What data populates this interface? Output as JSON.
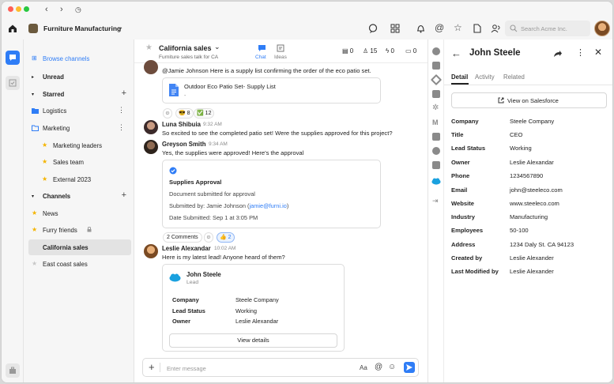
{
  "app": {
    "workspace_name": "Furniture Manufacturing",
    "search_placeholder": "Search Acme Inc."
  },
  "colors": {
    "accent": "#2f7df6",
    "salesforce": "#1aa1df",
    "star": "#f4b400"
  },
  "sidebar": {
    "browse": "Browse channels",
    "unread": "Unread",
    "starred": "Starred",
    "starred_items": [
      {
        "label": "Logistics",
        "icon": "folder-icon"
      },
      {
        "label": "Marketing",
        "icon": "folder-outline-icon"
      },
      {
        "label": "Marketing leaders",
        "icon": "star-icon"
      },
      {
        "label": "Sales team",
        "icon": "star-icon"
      },
      {
        "label": "External 2023",
        "icon": "star-icon"
      }
    ],
    "channels": "Channels",
    "channel_items": [
      {
        "label": "News"
      },
      {
        "label": "Furry friends"
      },
      {
        "label": "California sales"
      },
      {
        "label": "East coast sales"
      }
    ]
  },
  "channel": {
    "name": "California sales",
    "description": "Furniture sales talk for CA",
    "tab_chat": "Chat",
    "tab_ideas": "Ideas",
    "stats": [
      "0",
      "15",
      "0",
      "0"
    ]
  },
  "messages": {
    "m0_text": "@Jamie Johnson Here is a supply list confirming the order of the eco patio set.",
    "m0_file": "Outdoor Eco Patio Set- Supply List",
    "m0_file_sub": "-",
    "m0_react1": "8",
    "m0_react2": "12",
    "m1_name": "Luna Shibuia",
    "m1_time": "9:32 AM",
    "m1_text": "So excited to see the completed patio set! Were the supplies approved for this project?",
    "m2_name": "Greyson Smith",
    "m2_time": "9:34 AM",
    "m2_text": "Yes, the supplies were approved! Here's the approval",
    "approval_title": "Supplies Approval",
    "approval_line1": "Document submitted for approval",
    "approval_line2_prefix": "Submitted by: Jamie Johnson (",
    "approval_line2_link": "jamie@furni.io",
    "approval_line2_suffix": ")",
    "approval_line3": "Date Submitted: Sep 1 at 3:05 PM",
    "m2_comments": "2 Comments",
    "m2_react": "2",
    "m3_name": "Leslie Alexandar",
    "m3_time": "10:02 AM",
    "m3_text": "Here is my latest lead! Anyone heard of them?",
    "lead_name": "John Steele",
    "lead_sub": "Lead",
    "lead_rows": [
      {
        "k": "Company",
        "v": "Steele Company"
      },
      {
        "k": "Lead Status",
        "v": "Working"
      },
      {
        "k": "Owner",
        "v": "Leslie Alexandar"
      }
    ],
    "lead_button": "View details"
  },
  "composer": {
    "placeholder": "Enter message",
    "aa": "Aa"
  },
  "detail": {
    "name": "John Steele",
    "tabs": [
      "Detail",
      "Activity",
      "Related"
    ],
    "view_button": "View on Salesforce",
    "fields": [
      {
        "k": "Company",
        "v": "Steele Company"
      },
      {
        "k": "Title",
        "v": "CEO"
      },
      {
        "k": "Lead Status",
        "v": "Working"
      },
      {
        "k": "Owner",
        "v": "Leslie Alexandar"
      },
      {
        "k": "Phone",
        "v": "1234567890"
      },
      {
        "k": "Email",
        "v": "john@steeleco.com"
      },
      {
        "k": "Website",
        "v": "www.steeleco.com"
      },
      {
        "k": "Industry",
        "v": "Manufacturing"
      },
      {
        "k": "Employees",
        "v": "50-100"
      },
      {
        "k": "Address",
        "v": "1234 Daly St. CA 94123"
      },
      {
        "k": "Created by",
        "v": "Leslie Alexander"
      },
      {
        "k": "Last Modified by",
        "v": "Leslie Alexander"
      }
    ]
  }
}
